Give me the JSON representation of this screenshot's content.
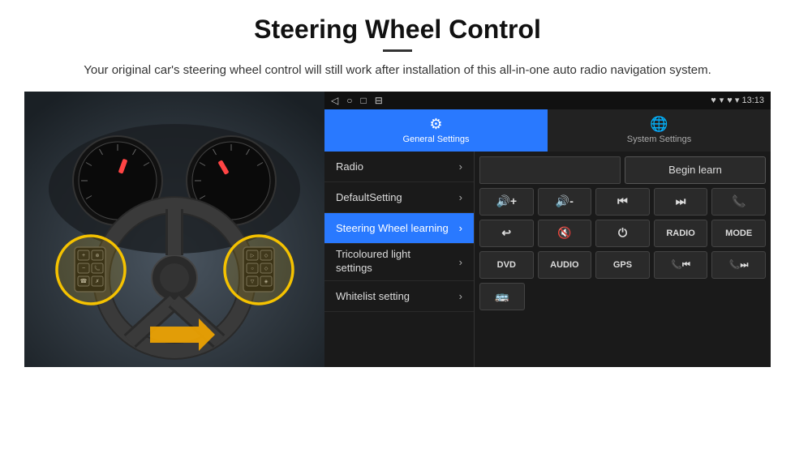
{
  "page": {
    "title": "Steering Wheel Control",
    "subtitle": "Your original car's steering wheel control will still work after installation of this all-in-one auto radio navigation system.",
    "divider": true
  },
  "android_ui": {
    "status_bar": {
      "left_icons": [
        "◁",
        "○",
        "□",
        "⊟"
      ],
      "right_info": "♥ ▾ 13:13"
    },
    "tabs": [
      {
        "id": "general",
        "icon": "⚙",
        "label": "General Settings",
        "active": true
      },
      {
        "id": "system",
        "icon": "🌐",
        "label": "System Settings",
        "active": false
      }
    ],
    "menu_items": [
      {
        "id": "radio",
        "label": "Radio",
        "active": false
      },
      {
        "id": "default",
        "label": "DefaultSetting",
        "active": false
      },
      {
        "id": "steering",
        "label": "Steering Wheel learning",
        "active": true
      },
      {
        "id": "tricoloured",
        "label": "Tricoloured light settings",
        "active": false
      },
      {
        "id": "whitelist",
        "label": "Whitelist setting",
        "active": false
      }
    ],
    "controls": {
      "begin_learn_label": "Begin learn",
      "icon_rows": [
        [
          {
            "icon": "🔊+",
            "label": "vol+"
          },
          {
            "icon": "🔊-",
            "label": "vol-"
          },
          {
            "icon": "⏮",
            "label": "prev"
          },
          {
            "icon": "⏭",
            "label": "next"
          },
          {
            "icon": "📞",
            "label": "call"
          }
        ],
        [
          {
            "icon": "↩",
            "label": "back"
          },
          {
            "icon": "🔇",
            "label": "mute"
          },
          {
            "icon": "⏻",
            "label": "power"
          },
          {
            "icon": "RADIO",
            "label": "radio"
          },
          {
            "icon": "MODE",
            "label": "mode"
          }
        ],
        [
          {
            "icon": "DVD",
            "label": "dvd"
          },
          {
            "icon": "AUDIO",
            "label": "audio"
          },
          {
            "icon": "GPS",
            "label": "gps"
          },
          {
            "icon": "📞⏮",
            "label": "tel-prev"
          },
          {
            "icon": "📞⏭",
            "label": "tel-next"
          }
        ],
        [
          {
            "icon": "🚌",
            "label": "bus"
          }
        ]
      ]
    }
  }
}
